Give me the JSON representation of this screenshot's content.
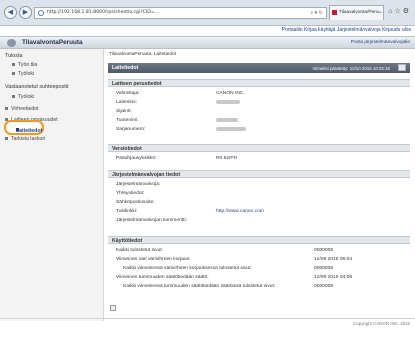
{
  "browser": {
    "url": "http://192.168.1.81:8000/rps/sheetlo.cgi?CID=...",
    "tab_title": "Tilaavalvonta/Peru..."
  },
  "header": {
    "top_links": "Portaaliin  Kirjaa käyttäjä  Järjestelmänvalvoja Kirjaudu ulos",
    "title": "TilavalvontaPeruuta",
    "right_link": "Posta järjestelmänvalvojalle"
  },
  "sidebar": {
    "groups": [
      {
        "heading": "Tulosta",
        "items": [
          "Työn tila",
          "Työloki"
        ]
      },
      {
        "heading": "Vastaanotetut suhteepostit",
        "items": [
          "Työloki"
        ]
      }
    ],
    "top_items": [
      "Virheetiedot",
      "Laitteen omaisuudet"
    ],
    "active_item": "Laitetiedot",
    "last_item": "Tarkista laskuri"
  },
  "main": {
    "breadcrumb": "TilavalvontaPeruuta: Laitetiedot",
    "page_title": "Laitetiedot",
    "last_updated": "Viimeksi päivitetty: 12/10 2015 10:32:16",
    "sections": {
      "device": {
        "title": "Laitteen perustiedot",
        "rows": [
          {
            "label": "Valmistaja:",
            "value": "CANON INC."
          },
          {
            "label": "Laitenimi:",
            "value": ""
          },
          {
            "label": "Sijainti:",
            "value": ""
          },
          {
            "label": "Tuotenimi:",
            "value": ""
          },
          {
            "label": "Sarjanumero:",
            "value": ""
          }
        ]
      },
      "version": {
        "title": "Versiotiedot",
        "rows": [
          {
            "label": "Pääohjausyksikkö:",
            "value": "R0.52/PH"
          }
        ]
      },
      "admin": {
        "title": "Järjestelmänvalvojan tiedot",
        "rows": [
          {
            "label": "Järjestelmänvalvoja:",
            "value": ""
          },
          {
            "label": "Yhteystiedot:",
            "value": ""
          },
          {
            "label": "Sähköpostiosoite:",
            "value": ""
          },
          {
            "label": "Tukilinkki:",
            "value": "http://www.canon.com"
          },
          {
            "label": "Järjestelmänvalvojan kommentti:",
            "value": ""
          }
        ]
      },
      "usage": {
        "title": "Käyttötiedot",
        "rows": [
          {
            "label": "Kaikki tulostetut sivut:",
            "value": "0000008"
          },
          {
            "label": "Viimeinen väri värivihreen korjaus:",
            "value": "12/09 2015 06:04"
          },
          {
            "label": "Kaikki viimeisessä värivirheen korjauksessa tulostetut sivut:",
            "value": "0000008"
          },
          {
            "label": "Viimeinen tummuuden säätötiedään säätö:",
            "value": "12/09 2015 04:06"
          },
          {
            "label": "Kaikki viimeisessä tummuuden säätötiedään säätöissä tulostetut sivut:",
            "value": "0000008"
          }
        ]
      }
    }
  },
  "footer": {
    "copyright": "Copyright CANON INC. 2015"
  }
}
